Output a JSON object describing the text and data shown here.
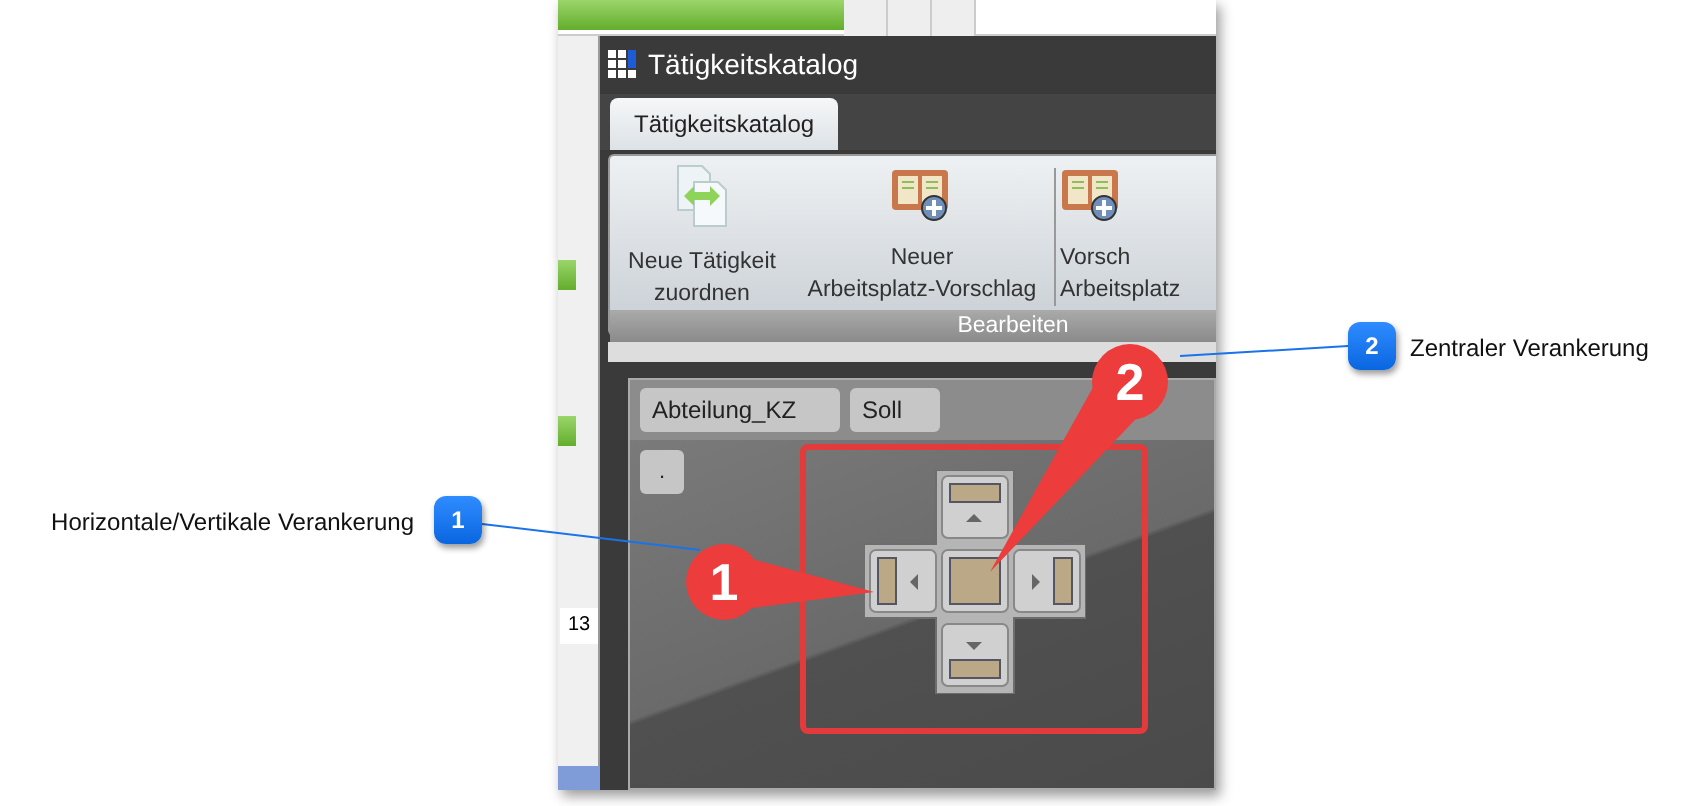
{
  "background_app": {
    "cell_text": "13"
  },
  "window": {
    "title": "Tätigkeitskatalog"
  },
  "tabs": [
    {
      "label": "Tätigkeitskatalog",
      "selected": true
    }
  ],
  "ribbon": {
    "buttons": [
      {
        "kind": "swap",
        "lines": [
          "Neue Tätigkeit",
          "zuordnen"
        ]
      },
      {
        "kind": "proposal",
        "lines": [
          "Neuer",
          "Arbeitsplatz-Vorschlag"
        ]
      },
      {
        "kind": "proposal",
        "lines": [
          "Vorsch",
          "Arbeitsplatz"
        ]
      }
    ],
    "group_label": "Bearbeiten"
  },
  "grid": {
    "columns": [
      "Abteilung_KZ",
      "Soll"
    ],
    "row_button": "."
  },
  "callouts": [
    {
      "number": "1",
      "pin_number": "1",
      "text": "Horizontale/Vertikale Verankerung"
    },
    {
      "number": "2",
      "pin_number": "2",
      "text": "Zentraler Verankerung"
    }
  ]
}
